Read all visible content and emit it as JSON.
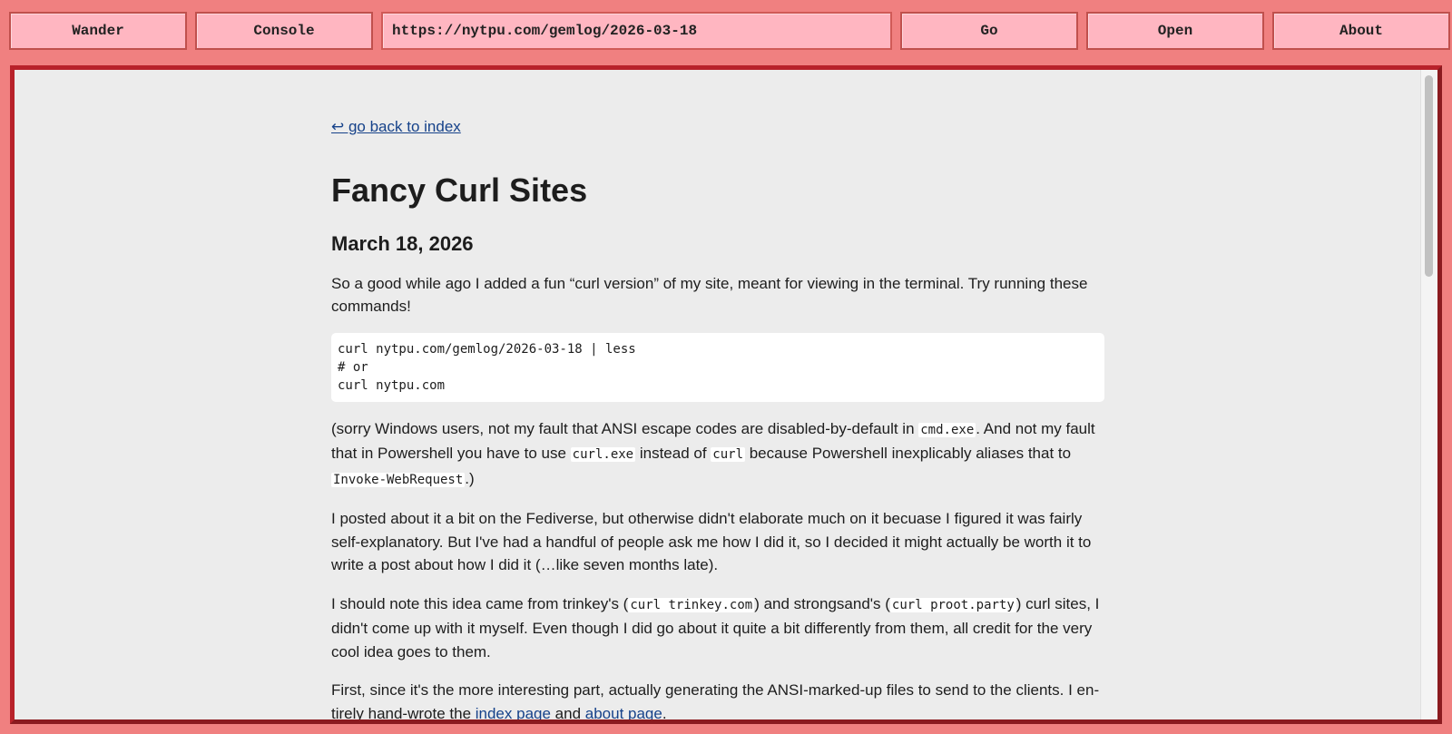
{
  "toolbar": {
    "wander": "Wander",
    "console": "Console",
    "url": "https://nytpu.com/gemlog/2026-03-18",
    "go": "Go",
    "open": "Open",
    "about": "About"
  },
  "page": {
    "back_link": "↩ go back to index",
    "title": "Fancy Curl Sites",
    "date": "March 18, 2026",
    "p1": "So a good while ago I added a fun “curl version” of my site, meant for viewing in the terminal. Try running these commands!",
    "code_lines": [
      "curl nytpu.com/gemlog/2026-03-18 | less",
      "# or",
      "curl nytpu.com"
    ],
    "p2": {
      "t1": "(sorry Windows users, not my fault that ANSI escape codes are disabled-by-default in ",
      "c1": "cmd.exe",
      "t2": ". And not my fault that in Powershell you have to use ",
      "c2": "curl.exe",
      "t3": " instead of ",
      "c3": "curl",
      "t4": " because Powershell inexplicably aliases that to ",
      "c4": "Invoke-WebRequest",
      "t5": ".)"
    },
    "p3": "I posted about it a bit on the Fediverse, but otherwise didn't elaborate much on it becuase I figured it was fairly self-explanatory. But I've had a handful of people ask me how I did it, so I decided it might actually be worth it to write a post about how I did it (…like seven months late).",
    "p4": {
      "t1": "I should note this idea came from trinkey's (",
      "c1": "curl trinkey.com",
      "t2": ") and strongsand's (",
      "c2": "curl proot.party",
      "t3": ") curl sites, I didn't come up with it myself. Even though I did go about it quite a bit differently from them, all credit for the very cool idea goes to them."
    },
    "p5": {
      "t1": "First, since it's the more interesting part, actually generating the ANSI-marked-up files to send to the clients. I en­tirely hand-wrote the ",
      "link1": "index page",
      "t2": " and ",
      "link2": "about page",
      "t3": "."
    }
  }
}
